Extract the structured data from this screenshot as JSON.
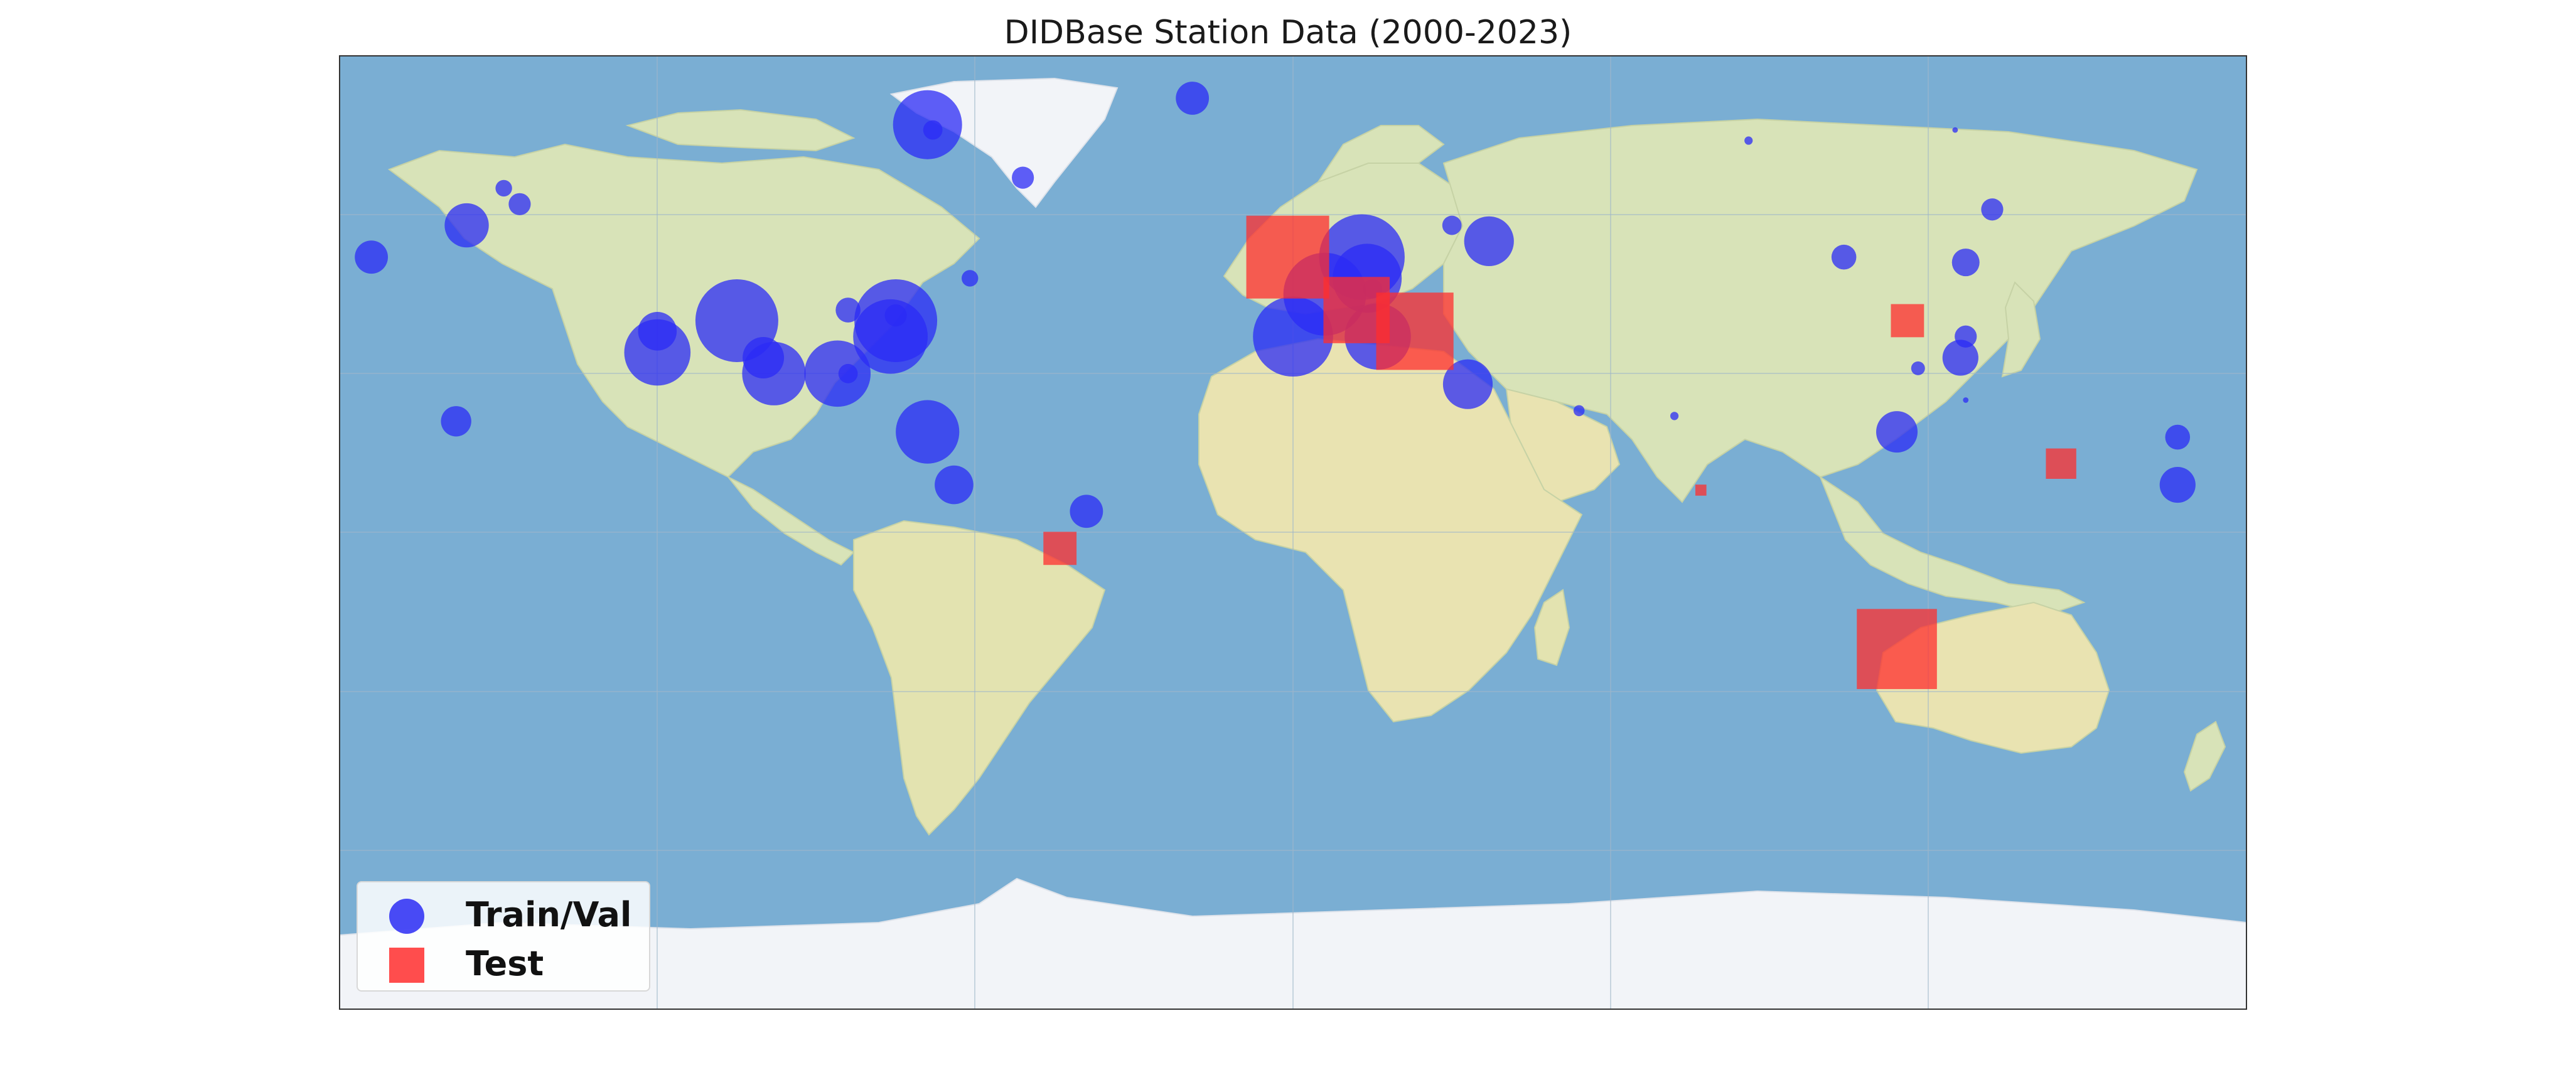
{
  "title": "DIDBase Station Data (2000-2023)",
  "colors": {
    "ocean": "#7aaed3",
    "land": "#d8e3b8",
    "land_dry": "#e9e3b1",
    "ice": "#f2f4f8",
    "train": "#1f1ff0",
    "test": "#ff2a2a",
    "grid": "#9fb7c9"
  },
  "legend": {
    "placement": "lower-left",
    "items": [
      {
        "label": "Train/Val",
        "marker": "circle",
        "color": "#2b2bf5"
      },
      {
        "label": "Test",
        "marker": "square",
        "color": "#ff2e2e"
      }
    ]
  },
  "chart_data": {
    "type": "scatter",
    "projection": "plate-carree",
    "xlim": [
      -180,
      180
    ],
    "ylim": [
      -90,
      90
    ],
    "grid": true,
    "series": [
      {
        "name": "Train/Val",
        "marker": "circle",
        "points": [
          {
            "lon": -174,
            "lat": 52,
            "size": 1.2
          },
          {
            "lon": -156,
            "lat": 58,
            "size": 1.6
          },
          {
            "lon": -149,
            "lat": 65,
            "size": 0.6
          },
          {
            "lon": -146,
            "lat": 62,
            "size": 0.8
          },
          {
            "lon": -158,
            "lat": 21,
            "size": 1.1
          },
          {
            "lon": -120,
            "lat": 38,
            "size": 1.4
          },
          {
            "lon": -105,
            "lat": 40,
            "size": 3.0
          },
          {
            "lon": -120,
            "lat": 34,
            "size": 2.4
          },
          {
            "lon": -100,
            "lat": 33,
            "size": 1.5
          },
          {
            "lon": -98,
            "lat": 30,
            "size": 2.3
          },
          {
            "lon": -86,
            "lat": 30,
            "size": 2.4
          },
          {
            "lon": -84,
            "lat": 30,
            "size": 0.7
          },
          {
            "lon": -84,
            "lat": 42,
            "size": 0.9
          },
          {
            "lon": -76,
            "lat": 37,
            "size": 2.7
          },
          {
            "lon": -75,
            "lat": 40,
            "size": 3.0
          },
          {
            "lon": -75,
            "lat": 41,
            "size": 0.8
          },
          {
            "lon": -61,
            "lat": 48,
            "size": 0.6
          },
          {
            "lon": -69,
            "lat": 19,
            "size": 2.3
          },
          {
            "lon": -64,
            "lat": 9,
            "size": 1.4
          },
          {
            "lon": -39,
            "lat": 4,
            "size": 1.2
          },
          {
            "lon": -69,
            "lat": 77,
            "size": 2.5
          },
          {
            "lon": -68,
            "lat": 76,
            "size": 0.7
          },
          {
            "lon": -51,
            "lat": 67,
            "size": 0.8
          },
          {
            "lon": -19,
            "lat": 82,
            "size": 1.2
          },
          {
            "lon": 6,
            "lat": 45,
            "size": 3.0
          },
          {
            "lon": 13,
            "lat": 52,
            "size": 3.1
          },
          {
            "lon": 14,
            "lat": 48,
            "size": 2.5
          },
          {
            "lon": 15,
            "lat": 46,
            "size": 0.7
          },
          {
            "lon": 0,
            "lat": 37,
            "size": 2.9
          },
          {
            "lon": 16,
            "lat": 37,
            "size": 2.4
          },
          {
            "lon": 30,
            "lat": 58,
            "size": 0.7
          },
          {
            "lon": 37,
            "lat": 55,
            "size": 1.8
          },
          {
            "lon": 33,
            "lat": 28,
            "size": 1.8
          },
          {
            "lon": 54,
            "lat": 23,
            "size": 0.4
          },
          {
            "lon": 72,
            "lat": 22,
            "size": 0.3
          },
          {
            "lon": 104,
            "lat": 52,
            "size": 0.9
          },
          {
            "lon": 127,
            "lat": 51,
            "size": 1.0
          },
          {
            "lon": 132,
            "lat": 61,
            "size": 0.8
          },
          {
            "lon": 86,
            "lat": 74,
            "size": 0.3
          },
          {
            "lon": 125,
            "lat": 76,
            "size": 0.2
          },
          {
            "lon": 127,
            "lat": 37,
            "size": 0.8
          },
          {
            "lon": 126,
            "lat": 33,
            "size": 1.3
          },
          {
            "lon": 118,
            "lat": 31,
            "size": 0.5
          },
          {
            "lon": 114,
            "lat": 19,
            "size": 1.5
          },
          {
            "lon": 127,
            "lat": 25,
            "size": 0.2
          },
          {
            "lon": 167,
            "lat": 18,
            "size": 0.9
          },
          {
            "lon": 167,
            "lat": 9,
            "size": 1.3
          }
        ]
      },
      {
        "name": "Test",
        "marker": "square",
        "points": [
          {
            "lon": -1,
            "lat": 52,
            "size": 3.0
          },
          {
            "lon": 12,
            "lat": 42,
            "size": 2.4
          },
          {
            "lon": 23,
            "lat": 38,
            "size": 2.8
          },
          {
            "lon": 116,
            "lat": 40,
            "size": 1.2
          },
          {
            "lon": 145,
            "lat": 13,
            "size": 1.1
          },
          {
            "lon": 77,
            "lat": 8,
            "size": 0.4
          },
          {
            "lon": -44,
            "lat": -3,
            "size": 1.2
          },
          {
            "lon": 114,
            "lat": -22,
            "size": 2.9
          }
        ]
      }
    ]
  }
}
